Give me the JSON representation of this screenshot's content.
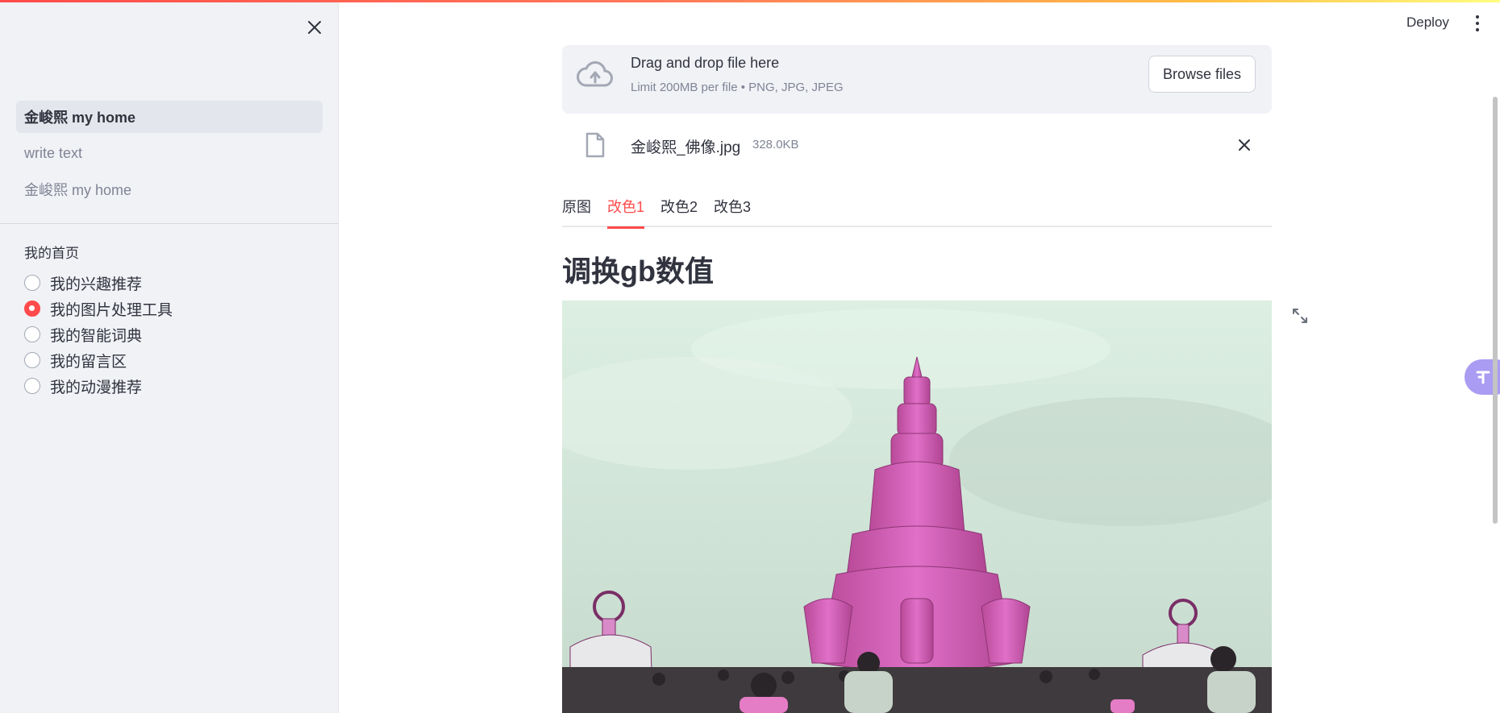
{
  "header": {
    "deploy_label": "Deploy"
  },
  "sidebar": {
    "nav_items": [
      {
        "label": "金峻熙 my home",
        "active": true
      },
      {
        "label": "write text",
        "active": false
      },
      {
        "label": "金峻熙 my home",
        "active": false
      }
    ],
    "radio": {
      "title": "我的首页",
      "options": [
        {
          "label": "我的兴趣推荐",
          "checked": false
        },
        {
          "label": "我的图片处理工具",
          "checked": true
        },
        {
          "label": "我的智能词典",
          "checked": false
        },
        {
          "label": "我的留言区",
          "checked": false
        },
        {
          "label": "我的动漫推荐",
          "checked": false
        }
      ]
    }
  },
  "uploader": {
    "title": "Drag and drop file here",
    "limit_text": "Limit 200MB per file • PNG, JPG, JPEG",
    "browse_label": "Browse files",
    "file": {
      "name": "金峻熙_佛像.jpg",
      "size": "328.0KB"
    }
  },
  "tabs": [
    {
      "label": "原图",
      "active": false
    },
    {
      "label": "改色1",
      "active": true
    },
    {
      "label": "改色2",
      "active": false
    },
    {
      "label": "改色3",
      "active": false
    }
  ],
  "main": {
    "heading": "调换gb数值"
  },
  "colors": {
    "accent": "#ff4b4b",
    "sidebar_bg": "#f0f2f6",
    "statue_pink": "#d85fb8",
    "sky": "#d6e8dc"
  },
  "icons": {
    "close": "close-icon",
    "upload": "cloud-upload-icon",
    "file": "file-icon",
    "expand": "fullscreen-icon",
    "menu": "kebab-menu-icon"
  }
}
